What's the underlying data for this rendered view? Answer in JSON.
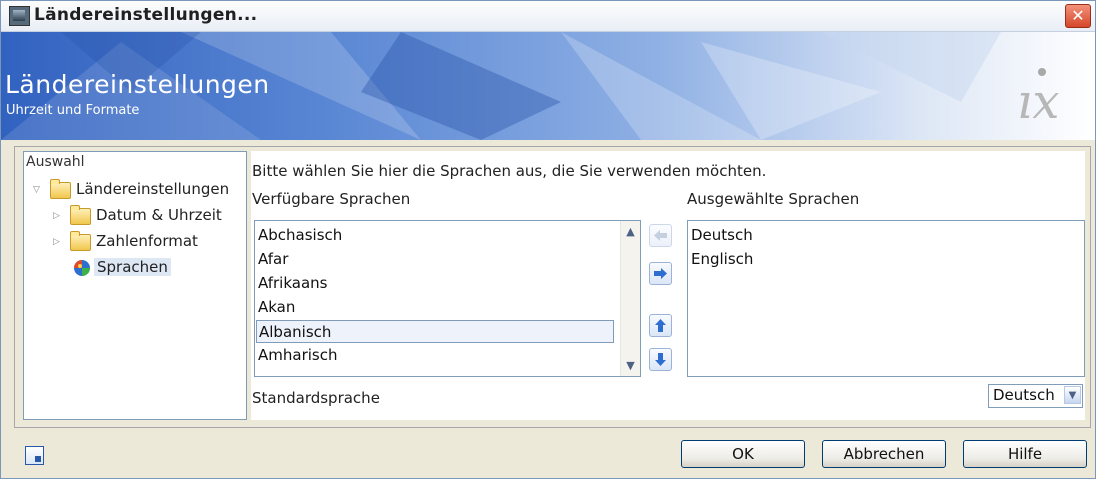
{
  "window": {
    "title": "Ländereinstellungen...",
    "close_glyph": "✕"
  },
  "banner": {
    "title": "Ländereinstellungen",
    "subtitle": "Uhrzeit und Formate",
    "logo_text": "ıx"
  },
  "tree": {
    "header": "Auswahl",
    "items": [
      {
        "label": "Ländereinstellungen",
        "icon": "folder-icon",
        "expanded": true
      },
      {
        "label": "Datum & Uhrzeit",
        "icon": "folder-icon",
        "expanded": false
      },
      {
        "label": "Zahlenformat",
        "icon": "folder-icon",
        "expanded": false
      },
      {
        "label": "Sprachen",
        "icon": "language-icon",
        "selected": true
      }
    ]
  },
  "languages": {
    "instruction": "Bitte wählen Sie hier die Sprachen aus, die Sie verwenden möchten.",
    "available_label": "Verfügbare Sprachen",
    "selected_label": "Ausgewählte Sprachen",
    "available": [
      "Abchasisch",
      "Afar",
      "Afrikaans",
      "Akan",
      "Albanisch",
      "Amharisch"
    ],
    "available_selected": "Albanisch",
    "selected": [
      "Deutsch",
      "Englisch"
    ],
    "default_label": "Standardsprache",
    "default_value": "Deutsch"
  },
  "buttons": {
    "ok": "OK",
    "cancel": "Abbrechen",
    "help": "Hilfe"
  },
  "colors": {
    "banner_blue": "#3262c0",
    "arrow_blue": "#2f6ed1",
    "close_red": "#d5472a"
  }
}
